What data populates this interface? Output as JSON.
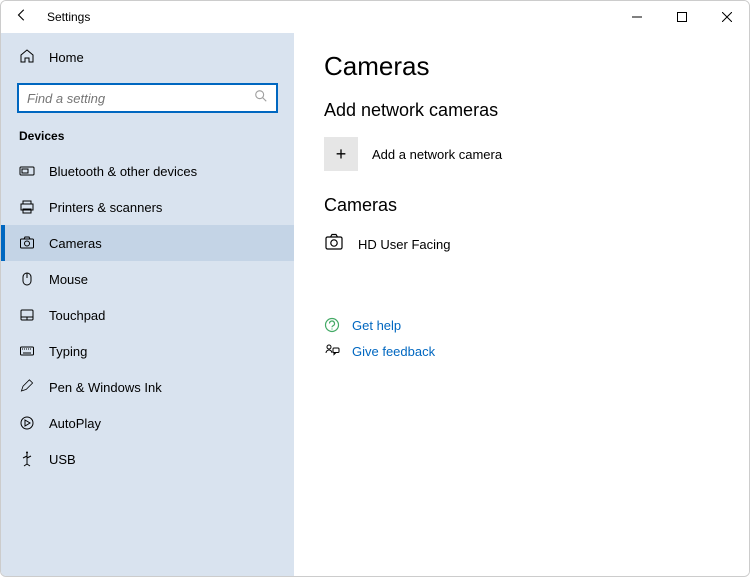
{
  "window": {
    "title": "Settings"
  },
  "search": {
    "placeholder": "Find a setting"
  },
  "sidebar": {
    "home": "Home",
    "group": "Devices",
    "items": [
      {
        "label": "Bluetooth & other devices"
      },
      {
        "label": "Printers & scanners"
      },
      {
        "label": "Cameras"
      },
      {
        "label": "Mouse"
      },
      {
        "label": "Touchpad"
      },
      {
        "label": "Typing"
      },
      {
        "label": "Pen & Windows Ink"
      },
      {
        "label": "AutoPlay"
      },
      {
        "label": "USB"
      }
    ]
  },
  "page": {
    "title": "Cameras",
    "add_section": "Add network cameras",
    "add_label": "Add a network camera",
    "list_section": "Cameras",
    "camera_name": "HD User Facing",
    "get_help": "Get help",
    "give_feedback": "Give feedback"
  }
}
